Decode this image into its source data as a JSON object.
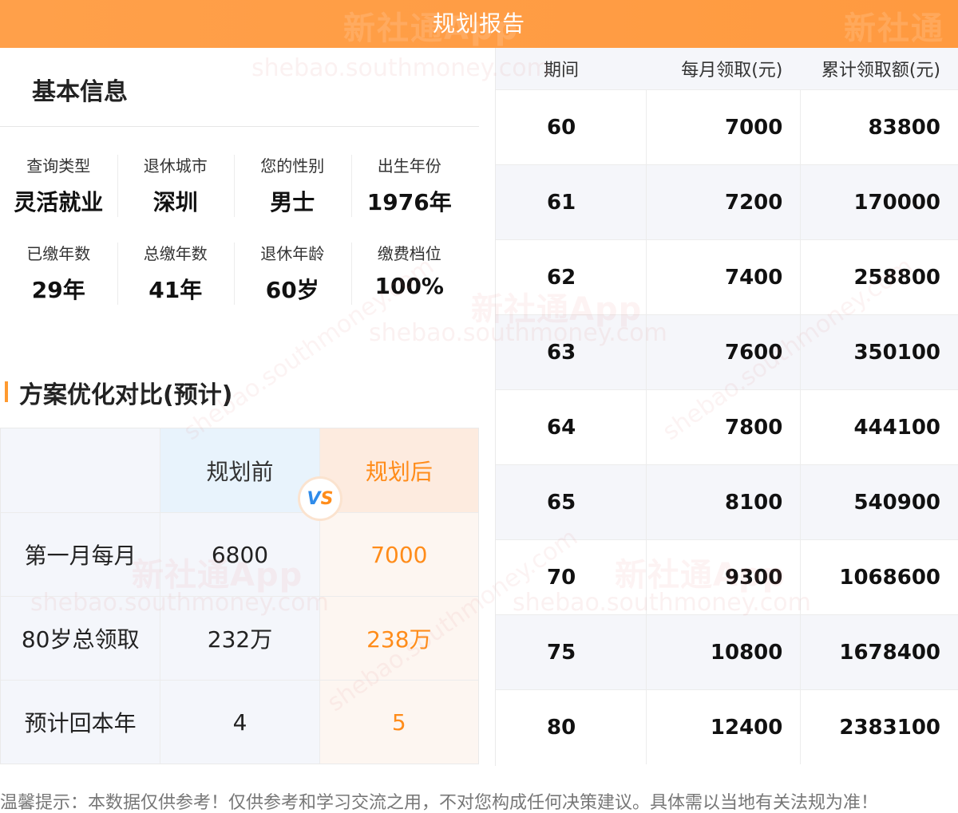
{
  "header": {
    "title": "规划报告"
  },
  "basic_info": {
    "title": "基本信息",
    "rows": [
      [
        {
          "label": "查询类型",
          "value": "灵活就业"
        },
        {
          "label": "退休城市",
          "value": "深圳"
        },
        {
          "label": "您的性别",
          "value": "男士"
        },
        {
          "label": "出生年份",
          "value": "1976年"
        }
      ],
      [
        {
          "label": "已缴年数",
          "value": "29年"
        },
        {
          "label": "总缴年数",
          "value": "41年"
        },
        {
          "label": "退休年龄",
          "value": "60岁"
        },
        {
          "label": "缴费档位",
          "value": "100%"
        }
      ]
    ]
  },
  "optimization": {
    "title": "方案优化对比(预计)",
    "head": [
      "",
      "规划前",
      "规划后"
    ],
    "vs": {
      "v": "V",
      "s": "S"
    },
    "rows": [
      [
        "第一月每月",
        "6800",
        "7000"
      ],
      [
        "80岁总领取",
        "232万",
        "238万"
      ],
      [
        "预计回本年",
        "4",
        "5"
      ]
    ]
  },
  "pension_table": {
    "columns": [
      "期间",
      "每月领取(元)",
      "累计领取额(元)"
    ],
    "rows": [
      [
        "60",
        "7000",
        "83800"
      ],
      [
        "61",
        "7200",
        "170000"
      ],
      [
        "62",
        "7400",
        "258800"
      ],
      [
        "63",
        "7600",
        "350100"
      ],
      [
        "64",
        "7800",
        "444100"
      ],
      [
        "65",
        "8100",
        "540900"
      ],
      [
        "70",
        "9300",
        "1068600"
      ],
      [
        "75",
        "10800",
        "1678400"
      ],
      [
        "80",
        "12400",
        "2383100"
      ]
    ]
  },
  "footer": {
    "text": "温馨提示：本数据仅供参考！仅供参考和学习交流之用，不对您构成任何决策建议。具体需以当地有关法规为准！"
  },
  "watermark": {
    "brand": "新社通App",
    "domain": "shebao.southmoney.com"
  },
  "colors": {
    "accent": "#ff9a40",
    "highlight_text": "#ff8c1a",
    "blue": "#2f8bea"
  }
}
